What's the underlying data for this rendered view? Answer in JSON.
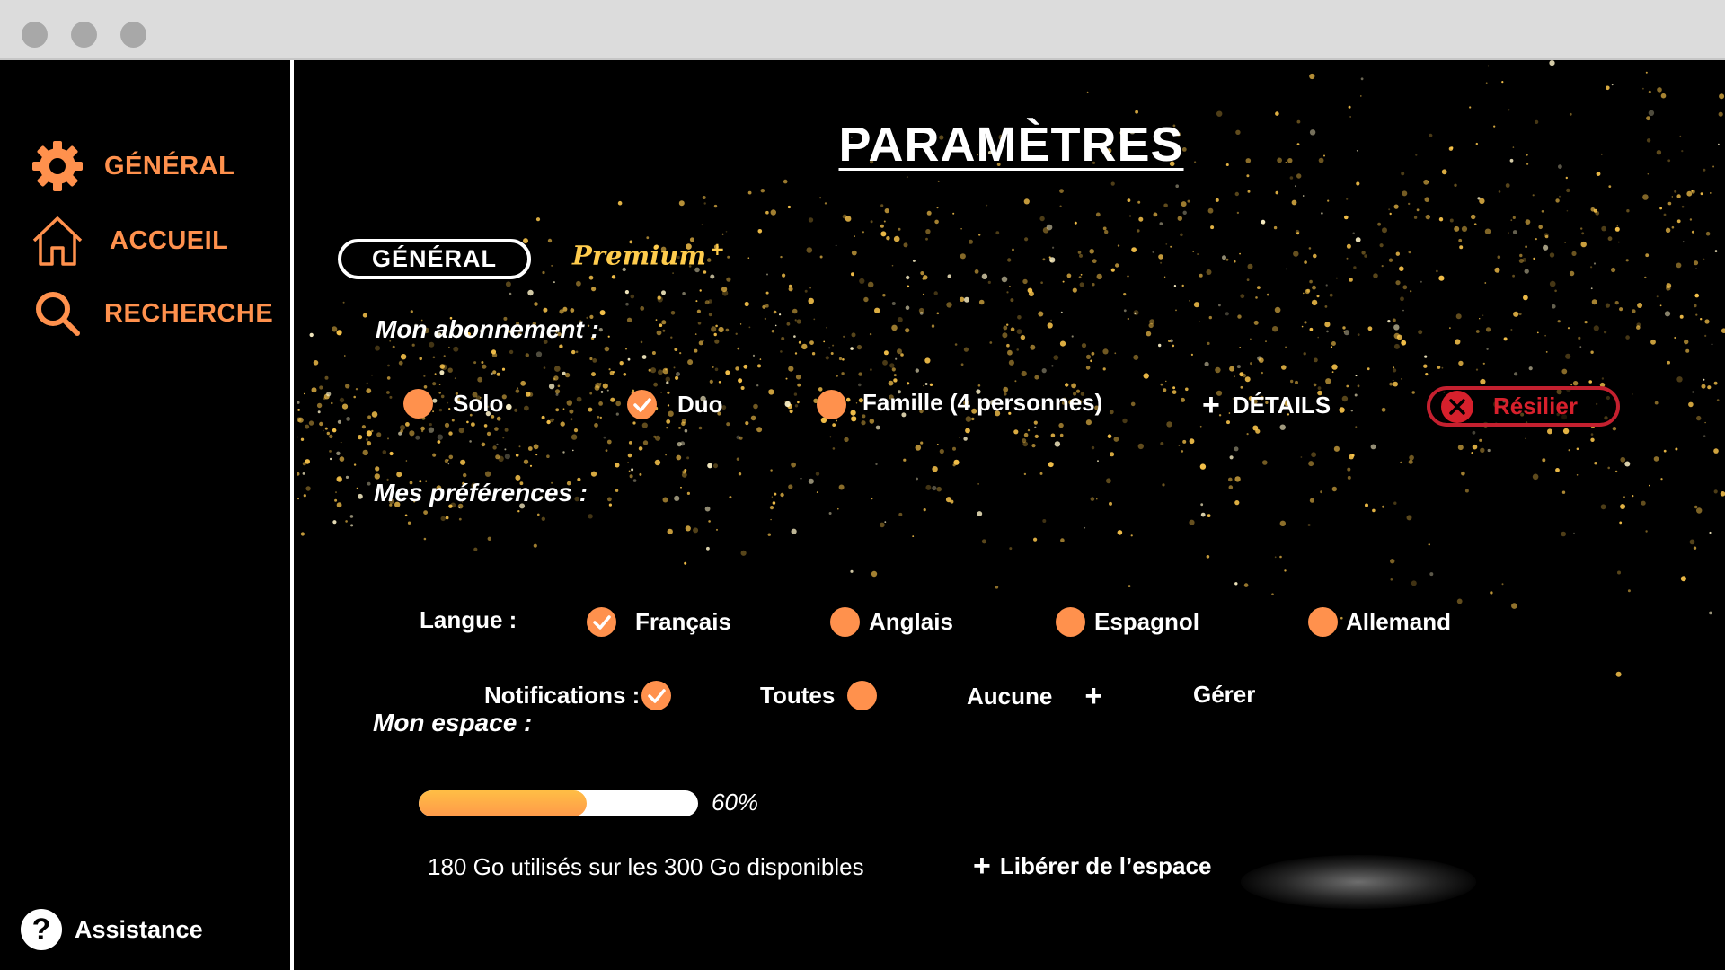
{
  "window": {
    "controls": [
      "close",
      "minimize",
      "maximize"
    ]
  },
  "sidebar": {
    "items": [
      {
        "label": "GÉNÉRAL",
        "icon": "gear-icon"
      },
      {
        "label": "ACCUEIL",
        "icon": "home-icon"
      },
      {
        "label": "RECHERCHE",
        "icon": "search-icon"
      }
    ],
    "assistance": {
      "label": "Assistance",
      "icon": "help-icon",
      "glyph": "?"
    }
  },
  "main": {
    "title": "PARAMÈTRES",
    "tabs": [
      {
        "label": "GÉNÉRAL",
        "active": true
      },
      {
        "label": "Premium",
        "sup": "+"
      }
    ],
    "subscription": {
      "heading": "Mon abonnement  :",
      "options": [
        {
          "label": "Solo",
          "checked": false
        },
        {
          "label": "Duo",
          "checked": true
        },
        {
          "label": "Famille (4 personnes)",
          "checked": false
        }
      ],
      "details_label": "DÉTAILS",
      "cancel_label": "Résilier"
    },
    "preferences": {
      "heading": "Mes préférences  :",
      "language": {
        "label": "Langue :",
        "options": [
          {
            "label": "Français",
            "checked": true
          },
          {
            "label": "Anglais",
            "checked": false
          },
          {
            "label": "Espagnol",
            "checked": false
          },
          {
            "label": "Allemand",
            "checked": false
          }
        ]
      },
      "notifications": {
        "label": "Notifications :",
        "options": [
          {
            "label": "Toutes",
            "checked": true
          },
          {
            "label": "Aucune",
            "checked": false
          }
        ],
        "manage_label": "Gérer"
      }
    },
    "storage": {
      "heading": "Mon espace :",
      "percent_value": 0.6,
      "percent_label": "60%",
      "usage_text": "180 Go utilisés sur les 300 Go disponibles",
      "free_label": "Libérer de l’espace"
    }
  },
  "colors": {
    "accent": "#ff914d",
    "premium": "#ffcc4d",
    "danger": "#d6202c",
    "background": "#000000",
    "sparkle": "#ffc94d"
  }
}
